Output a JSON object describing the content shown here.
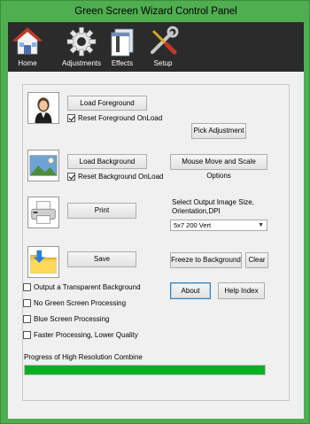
{
  "window": {
    "title": "Green Screen Wizard Control Panel"
  },
  "toolbar": [
    {
      "label": "Home",
      "icon": "house-icon"
    },
    {
      "label": "Adjustments",
      "icon": "gear-icon"
    },
    {
      "label": "Effects",
      "icon": "effects-icon"
    },
    {
      "label": "Setup",
      "icon": "tools-icon"
    }
  ],
  "foreground": {
    "load_label": "Load Foreground",
    "reset_label": "Reset Foreground OnLoad",
    "reset_checked": true
  },
  "background": {
    "load_label": "Load Background",
    "reset_label": "Reset Background OnLoad",
    "reset_checked": true
  },
  "print_label": "Print",
  "save_label": "Save",
  "pick_adjustment_label": "Pick Adjustment",
  "mouse_move_label": "Mouse Move and Scale Options",
  "output": {
    "select_label": "Select Output Image Size, Orientation,DPI",
    "selected": "5x7 200 Vert"
  },
  "freeze_label": "Freeze to Background",
  "clear_label": "Clear",
  "about_label": "About",
  "help_label": "Help Index",
  "options": [
    {
      "label": "Output a Transparent Background",
      "checked": false
    },
    {
      "label": "No Green Screen Processing",
      "checked": false
    },
    {
      "label": "Blue Screen Processing",
      "checked": false
    },
    {
      "label": "Faster Processing, Lower Quality",
      "checked": false
    }
  ],
  "progress": {
    "label": "Progress of High Resolution Combine",
    "value": 1.0,
    "color": "#06b025"
  }
}
